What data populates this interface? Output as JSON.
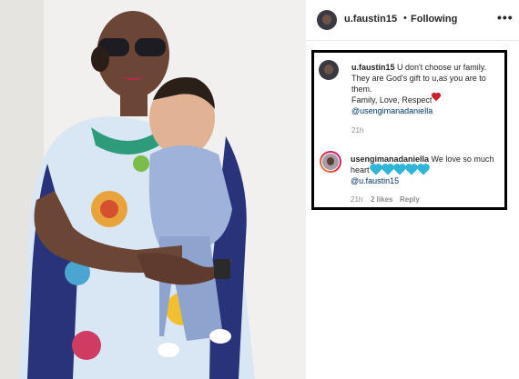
{
  "post": {
    "username": "u.faustin15",
    "separator": "•",
    "follow_status": "Following",
    "more_icon": "more-options-icon"
  },
  "comments": [
    {
      "username": "u.faustin15",
      "text": "U don't choose ur family. They are God's gift to u,as you are to them.",
      "line2": "Family, Love, Respect",
      "mention": "@usengimanadaniella",
      "time": "21h"
    },
    {
      "username": "usengimanadaniella",
      "text": "We love so much heart",
      "mention": "@u.faustin15",
      "time": "21h",
      "likes": "2 likes",
      "reply": "Reply",
      "heart_color": "#2fb5d8",
      "heart_count": 5
    }
  ]
}
